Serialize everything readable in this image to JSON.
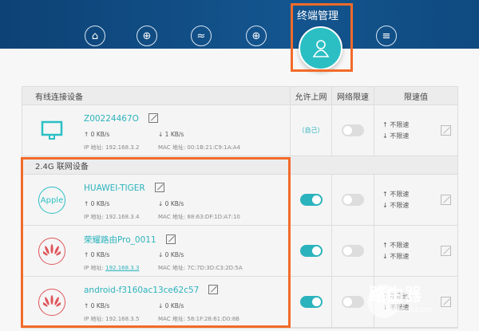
{
  "nav": {
    "active_title": "终端管理",
    "icons": [
      "home-icon",
      "globe-icon",
      "wifi-icon",
      "globe-speed-icon",
      "user-icon",
      "menu-icon"
    ]
  },
  "columns": {
    "device": "有线连接设备",
    "allow": "允许上网",
    "limit": "网络限速",
    "limit_value": "限速值"
  },
  "wired": [
    {
      "name": "Z00224467O",
      "up": "0 KB/s",
      "down": "1 KB/s",
      "ip": "IP 地址: 192.168.3.2",
      "mac": "MAC 地址: 00:1B:21:C9:1A:A4",
      "allow": "（自己）",
      "limit_on": false,
      "up_limit": "不限速",
      "down_limit": "不限速"
    }
  ],
  "section_24g": "2.4G 联网设备",
  "devices": [
    {
      "name": "HUAWEI-TIGER",
      "logo": "Apple",
      "up": "0 KB/s",
      "down": "0 KB/s",
      "ip_label": "IP 地址: ",
      "ip": "192.168.3.4",
      "mac": "MAC 地址: 88:63:DF:1D:A7:10",
      "allow_on": true,
      "limit_on": false,
      "up_limit": "不限速",
      "down_limit": "不限速"
    },
    {
      "name": "荣耀路由Pro_0011",
      "logo": "huawei",
      "up": "0 KB/s",
      "down": "0 KB/s",
      "ip_label": "IP 地址: ",
      "ip": "192.168.3.3",
      "mac": "MAC 地址: 7C:7D:3D:C3:2D:5A",
      "allow_on": true,
      "limit_on": false,
      "up_limit": "不限速",
      "down_limit": "不限速"
    },
    {
      "name": "android-f3160ac13ce62c57",
      "logo": "huawei",
      "up": "0 KB/s",
      "down": "0 KB/s",
      "ip_label": "IP 地址: ",
      "ip": "192.168.3.5",
      "mac": "MAC 地址: 58:1F:28:61:D0:8B",
      "allow_on": true,
      "limit_on": false,
      "up_limit": "不限速",
      "down_limit": "不限速"
    }
  ],
  "watermark": {
    "title": "路由器",
    "url": "luyouqi.com"
  },
  "colors": {
    "accent": "#2bbfc4",
    "highlight": "#f26b2a",
    "header": "#0d4275"
  }
}
